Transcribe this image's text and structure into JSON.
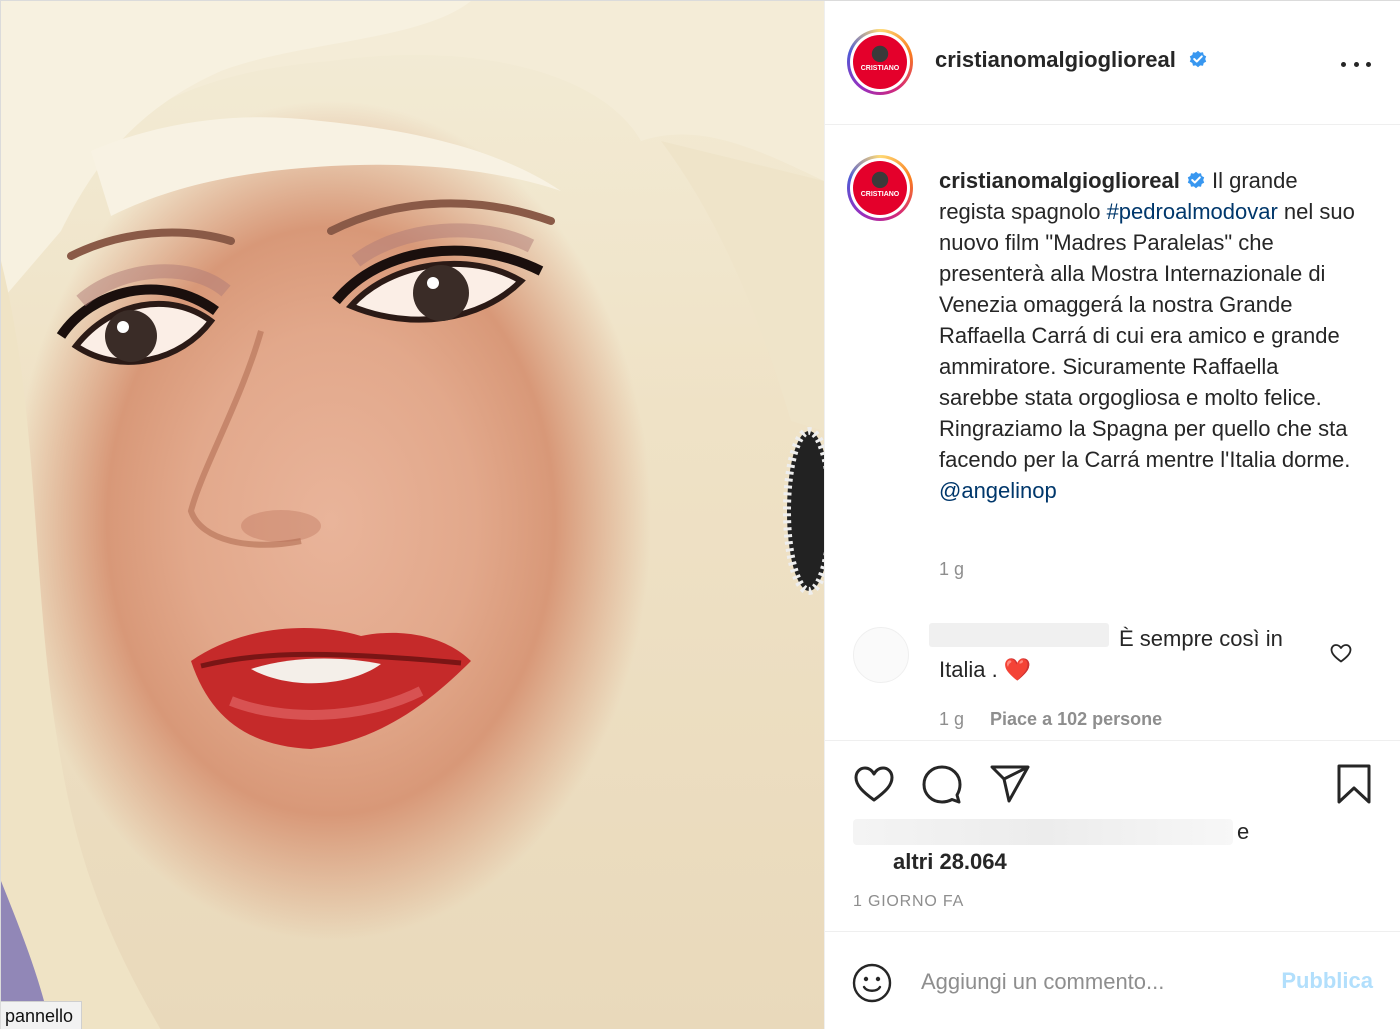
{
  "photo": {
    "label": "pannello"
  },
  "post": {
    "username": "cristianomalgioglioreal",
    "avatar_text": "CRISTIANO",
    "caption_parts": [
      "Il grande regista spagnolo ",
      "#pedroalmodovar",
      " nel suo nuovo film \"Madres Paralelas\" che presenterà alla Mostra Internazionale di Venezia omaggerá la nostra Grande Raffaella Carrá di cui era amico e grande ammiratore. Sicuramente Raffaella sarebbe stata orgogliosa e molto felice. Ringraziamo la Spagna per quello che sta facendo per la Carrá mentre l'Italia dorme. ",
      "@angelinop"
    ],
    "caption_time": "1 g"
  },
  "comment": {
    "text": "È sempre così in Italia . ❤️",
    "time": "1 g",
    "likes": "Piace a 102 persone"
  },
  "icons": {
    "more": "more-options-icon",
    "like": "heart-icon",
    "comment": "comment-icon",
    "share": "paper-plane-icon",
    "save": "bookmark-icon",
    "emoji": "emoji-icon",
    "verified": "verified-badge-icon"
  },
  "likes_row": {
    "connector": "e",
    "others": "altri 28.064"
  },
  "date": "1 GIORNO FA",
  "add_comment": {
    "placeholder": "Aggiungi un commento...",
    "publish": "Pubblica"
  },
  "colors": {
    "link": "#00376b",
    "muted": "#8e8e8e",
    "verified": "#3897f0",
    "publish_disabled": "#b2dffc",
    "heart_red": "#e0161e"
  }
}
